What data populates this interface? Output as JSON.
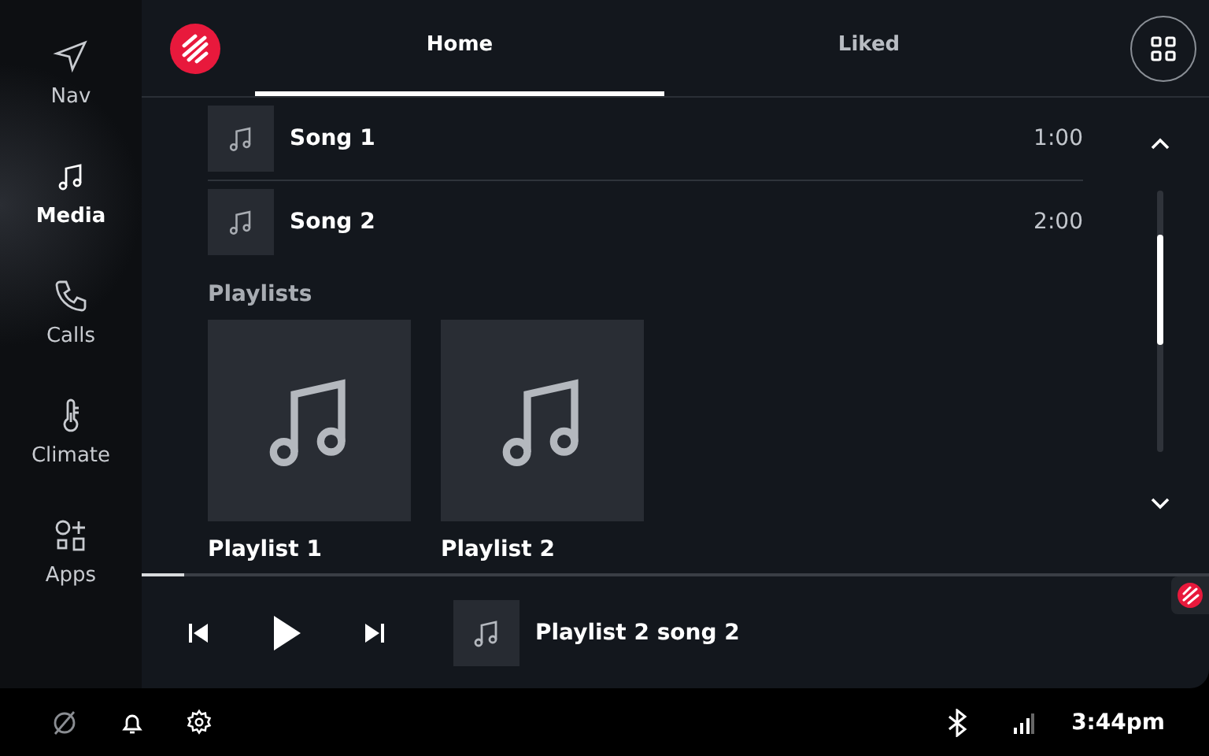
{
  "rail": [
    {
      "kind": "nav",
      "label": "Nav",
      "selected": false
    },
    {
      "kind": "media",
      "label": "Media",
      "selected": true
    },
    {
      "kind": "calls",
      "label": "Calls",
      "selected": false
    },
    {
      "kind": "climate",
      "label": "Climate",
      "selected": false
    },
    {
      "kind": "apps",
      "label": "Apps",
      "selected": false
    }
  ],
  "tabs": [
    {
      "label": "Home",
      "selected": true
    },
    {
      "label": "Liked",
      "selected": false
    }
  ],
  "songs": [
    {
      "title": "Song 1",
      "duration": "1:00"
    },
    {
      "title": "Song 2",
      "duration": "2:00"
    }
  ],
  "playlists": {
    "heading": "Playlists",
    "items": [
      {
        "title": "Playlist 1"
      },
      {
        "title": "Playlist 2"
      }
    ]
  },
  "now_playing": {
    "title": "Playlist 2 song 2",
    "level": 0.04
  },
  "status_bar": {
    "time": "3:44pm"
  }
}
